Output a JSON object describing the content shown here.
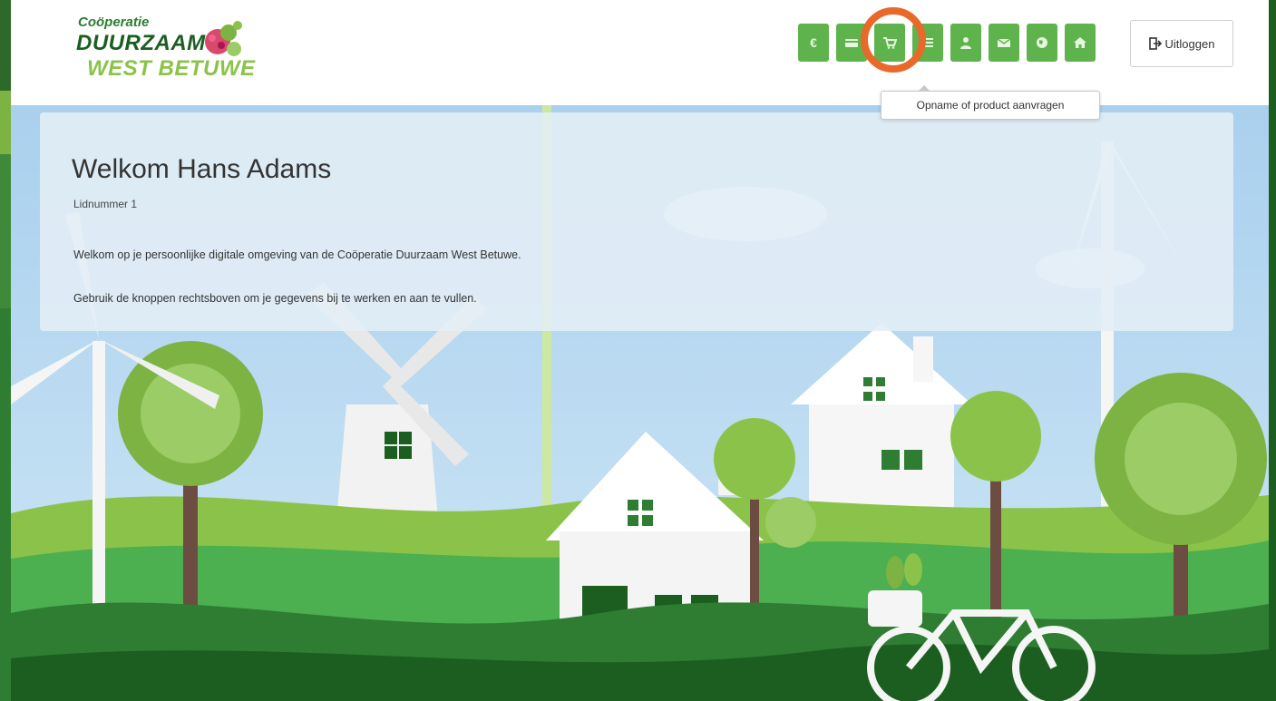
{
  "logo": {
    "line1": "Coöperatie",
    "line2": "DUURZAAM",
    "line3": "WEST BETUWE"
  },
  "nav": {
    "buttons": [
      {
        "name": "euro-button",
        "icon": "euro-icon"
      },
      {
        "name": "card-button",
        "icon": "credit-card-icon"
      },
      {
        "name": "cart-button",
        "icon": "shopping-cart-icon"
      },
      {
        "name": "list-button",
        "icon": "list-icon"
      },
      {
        "name": "user-button",
        "icon": "user-icon"
      },
      {
        "name": "mail-button",
        "icon": "envelope-icon"
      },
      {
        "name": "globe-button",
        "icon": "globe-icon"
      },
      {
        "name": "home-button",
        "icon": "home-icon"
      }
    ],
    "euro_glyph": "€",
    "logout_label": "Uitloggen",
    "tooltip": "Opname of product aanvragen"
  },
  "welcome": {
    "title": "Welkom Hans Adams",
    "member_number": "Lidnummer 1",
    "intro": "Welkom op je persoonlijke digitale omgeving van de Coöperatie Duurzaam West Betuwe.",
    "instruction": "Gebruik de knoppen rechtsboven om je gegevens bij te werken en aan te vullen."
  },
  "colors": {
    "brand_green": "#5fb34c",
    "dark_green": "#1b5e20",
    "highlight": "#e8692a",
    "sky": "#9cc8ea"
  }
}
